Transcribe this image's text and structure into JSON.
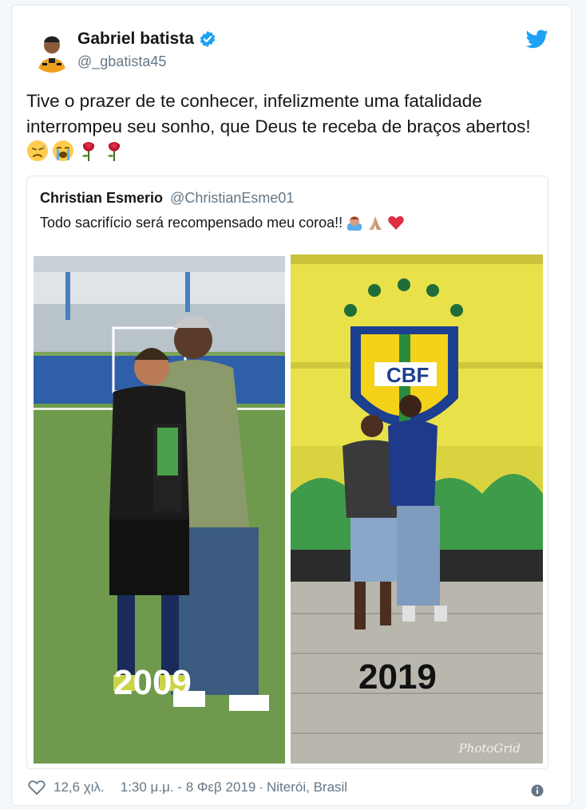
{
  "tweet": {
    "author_name": "Gabriel batista",
    "author_handle": "@_gbatista45",
    "text": "Tive o prazer de te conhecer, infelizmente uma fatalidade interrompeu seu sonho, que Deus te receba de braços abertos!",
    "emojis": [
      "disappointed-face-icon",
      "loudly-crying-face-icon",
      "rose-icon",
      "rose-icon"
    ]
  },
  "quoted": {
    "author_name": "Christian Esmerio",
    "author_handle": "@ChristianEsme01",
    "text": "Todo sacrifício será recompensado meu coroa!!",
    "emojis": [
      "person-bowing-icon",
      "folded-hands-icon",
      "red-heart-icon"
    ],
    "photo_left_year": "2009",
    "photo_right_year": "2019",
    "watermark": "PhotoGrid",
    "bus_text": "CBF"
  },
  "footer": {
    "likes": "12,6 χιλ.",
    "time_date": "1:30 μ.μ. - 8 Φεβ 2019",
    "separator": "·",
    "location": "Niterói, Brasil"
  },
  "colors": {
    "brand_blue": "#1da1f2",
    "muted": "#657786",
    "border": "#e1e8ed"
  }
}
